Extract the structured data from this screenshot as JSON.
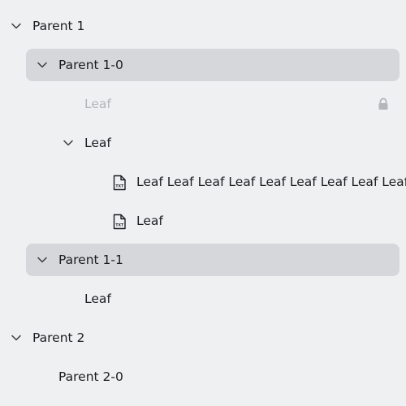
{
  "tree": {
    "parent_1": {
      "label": "Parent 1",
      "expanded": true,
      "icon": "chevron-down-icon"
    },
    "parent_1_0": {
      "label": "Parent 1-0",
      "expanded": true,
      "selected": true,
      "icon": "chevron-down-icon"
    },
    "leaf_disabled": {
      "label": "Leaf",
      "disabled": true,
      "icon": "lock-icon"
    },
    "leaf_folder": {
      "label": "Leaf",
      "expanded": true,
      "icon": "chevron-down-icon"
    },
    "leaf_long": {
      "label": "Leaf Leaf Leaf Leaf Leaf Leaf Leaf Leaf Leaf Leaf",
      "icon": "txt-file-icon"
    },
    "leaf_file": {
      "label": "Leaf",
      "icon": "txt-file-icon"
    },
    "parent_1_1": {
      "label": "Parent 1-1",
      "expanded": true,
      "selected": true,
      "icon": "chevron-down-icon"
    },
    "leaf_plain": {
      "label": "Leaf"
    },
    "parent_2": {
      "label": "Parent 2",
      "expanded": true,
      "icon": "chevron-down-icon"
    },
    "parent_2_0": {
      "label": "Parent 2-0"
    }
  },
  "colors": {
    "background": "#eff0f2",
    "selected": "#d6d7da",
    "text": "#1c1d20",
    "disabled_text": "#b4b6ba"
  }
}
